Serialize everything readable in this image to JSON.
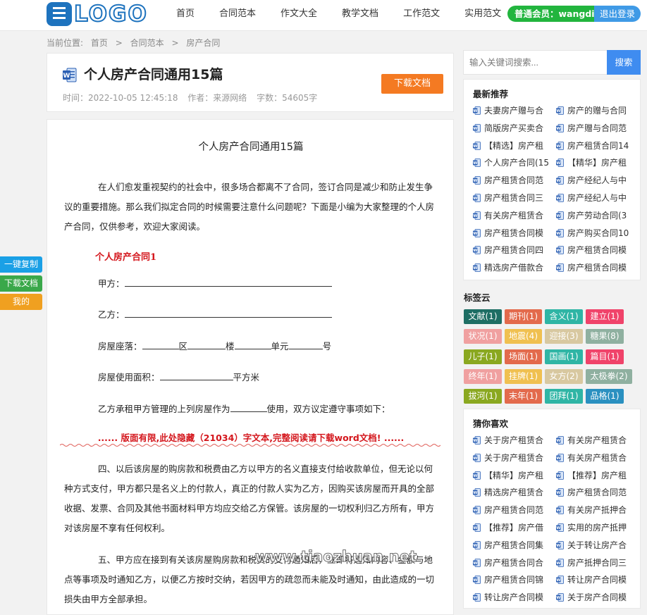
{
  "header": {
    "logo_text": "LOGO",
    "nav": [
      "首页",
      "合同范本",
      "作文大全",
      "教学文档",
      "工作范文",
      "实用范文"
    ],
    "member_label": "普通会员：wangdi",
    "logout_label": "退出登录"
  },
  "breadcrumb": {
    "prefix": "当前位置:",
    "items": [
      "首页",
      ">",
      "合同范本",
      ">",
      "房产合同"
    ]
  },
  "document": {
    "title": "个人房产合同通用15篇",
    "time": "时间：2022-10-05 12:45:18",
    "author": "作者：来源网络",
    "words": "字数：54605字",
    "download_label": "下载文档"
  },
  "content": {
    "heading": "个人房产合同通用15篇",
    "intro": "在人们愈发重视契约的社会中，很多场合都离不了合同，签订合同是减少和防止发生争议的重要措施。那么我们拟定合同的时候需要注意什么问题呢？下面是小编为大家整理的个人房产合同，仅供参考，欢迎大家阅读。",
    "section_title": "个人房产合同1",
    "party_a": "甲方：",
    "party_b": "乙方：",
    "location": {
      "label": "房屋座落：",
      "district": "区",
      "building": "楼",
      "unit": "单元",
      "room": "号"
    },
    "area": {
      "label": "房屋使用面积：",
      "unit": "平方米"
    },
    "use_clause": {
      "before": "乙方承租甲方管理的上列房屋作为",
      "after": "使用，双方议定遵守事项如下："
    },
    "hidden_note": "...... 版面有限,此处隐藏（21034）字文本,完整阅读请下载word文档! ......",
    "para4": "四、以后该房屋的购房款和税费由乙方以甲方的名义直接支付给收款单位，但无论以何种方式支付，甲方都只是名义上的付款人，真正的付款人实为乙方，因购买该房屋而开具的全部收据、发票、合同及其他书面材料甲方均应交给乙方保管。该房屋的一切权利归乙方所有，甲方对该房屋不享有任何权利。",
    "para5": "五、甲方应在接到有关该房屋购房款和税费的支付通知后，立即将通知内容、金额与地点等事项及时通知乙方，以便乙方按时交纳，若因甲方的疏忽而未能及时通知，由此造成的一切损失由甲方全部承担。",
    "watermark": "www.tiaozhuan.net"
  },
  "float_buttons": [
    "一键复制",
    "下载文档",
    "我的"
  ],
  "search": {
    "placeholder": "输入关键词搜索...",
    "button": "搜索"
  },
  "latest": {
    "title": "最新推荐",
    "items": [
      "夫妻房产赠与合",
      "房产的赠与合同",
      "简版房产买卖合",
      "房产赠与合同范",
      "【精选】房产租",
      "房产租赁合同14",
      "个人房产合同(15",
      "【精华】房产租",
      "房产租赁合同范",
      "房产经纪人与中",
      "房产租赁合同三",
      "房产经纪人与中",
      "有关房产租赁合",
      "房产劳动合同(3",
      "房产租赁合同模",
      "房产购买合同10",
      "房产租赁合同四",
      "房产租赁合同模",
      "精选房产借款合",
      "房产租赁合同模"
    ]
  },
  "tags": {
    "title": "标签云",
    "items": [
      {
        "label": "文献(1)",
        "color": "#1e6e64"
      },
      {
        "label": "期刊(1)",
        "color": "#e36a4c"
      },
      {
        "label": "含义(1)",
        "color": "#2fb5a5"
      },
      {
        "label": "建立(1)",
        "color": "#f0436a"
      },
      {
        "label": "状况(1)",
        "color": "#f0a0a0"
      },
      {
        "label": "地震(4)",
        "color": "#f0c050"
      },
      {
        "label": "迎接(3)",
        "color": "#d8c8a0"
      },
      {
        "label": "糖果(8)",
        "color": "#8fb0a0"
      },
      {
        "label": "儿子(1)",
        "color": "#8aa820"
      },
      {
        "label": "场面(1)",
        "color": "#e36a4c"
      },
      {
        "label": "国画(1)",
        "color": "#2fb5a5"
      },
      {
        "label": "篇目(1)",
        "color": "#f0436a"
      },
      {
        "label": "终年(1)",
        "color": "#f0a0a0"
      },
      {
        "label": "挂牌(1)",
        "color": "#f0c050"
      },
      {
        "label": "女方(2)",
        "color": "#d8c8a0"
      },
      {
        "label": "太极拳(2)",
        "color": "#8fb0a0"
      },
      {
        "label": "拔河(1)",
        "color": "#8aa820"
      },
      {
        "label": "末年(1)",
        "color": "#e36a4c"
      },
      {
        "label": "团拜(1)",
        "color": "#2fb5a5"
      },
      {
        "label": "品格(1)",
        "color": "#2a90c0"
      }
    ]
  },
  "guess": {
    "title": "猜你喜欢",
    "items": [
      "关于房产租赁合",
      "有关房产租赁合",
      "关于房产租赁合",
      "有关房产租赁合",
      "【精华】房产租",
      "【推荐】房产租",
      "精选房产租赁合",
      "房产租赁合同范",
      "房产租赁合同范",
      "有关房产抵押合",
      "【推荐】房产借",
      "实用的房产抵押",
      "房产租赁合同集",
      "关于转让房产合",
      "房产租赁合同合",
      "房产抵押合同三",
      "房产租赁合同锦",
      "转让房产合同模",
      "转让房产合同模",
      "关于房产合同模"
    ]
  },
  "colors": {
    "word_icon": "#2b5fb3",
    "member_green": "#22b53e",
    "logout_blue": "#3f9ae6",
    "download_orange": "#f47a22",
    "search_blue": "#3f8cf0",
    "float_copy": "#1aa0e6",
    "float_download": "#3aa84a",
    "float_mine": "#f0a020"
  }
}
